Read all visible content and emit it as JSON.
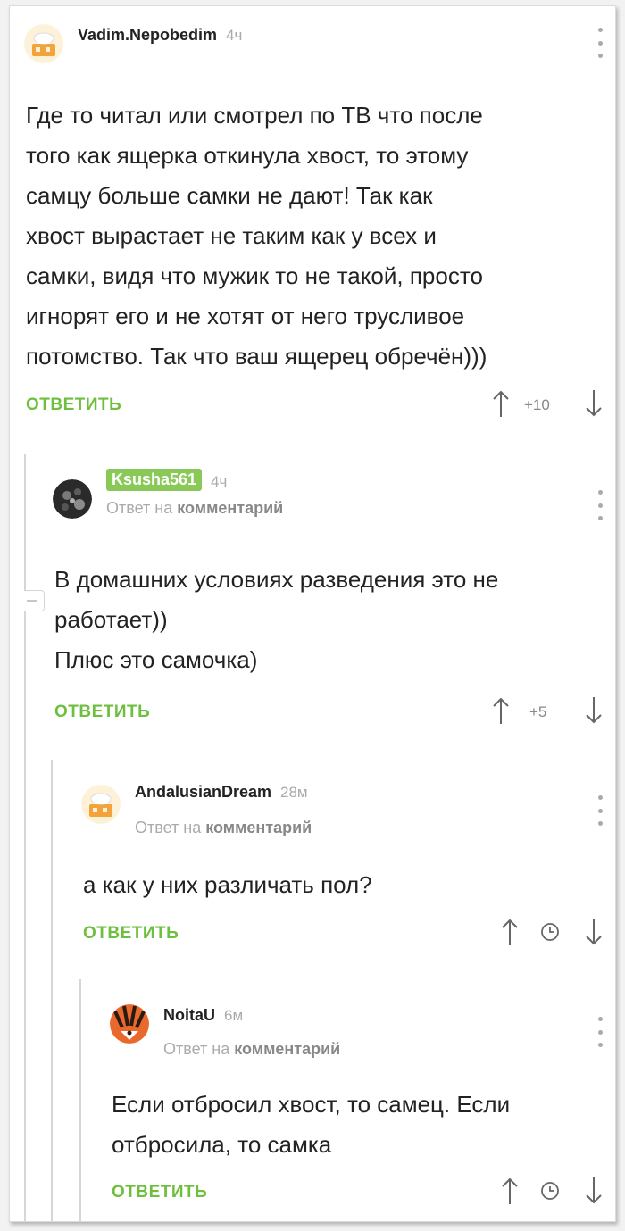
{
  "comments": [
    {
      "username": "Vadim.Nepobedim",
      "time": "4ч",
      "reply_to_prefix": "",
      "reply_to_link": "",
      "text": "Где то читал или смотрел по ТВ что после\nтого как ящерка откинула хвост, то этому\nсамцу больше самки не дают! Так как\nхвост вырастает не таким как у всех и\nсамки, видя что мужик то не такой, просто\nигнорят его и не хотят от него трусливое\nпотомство. Так что ваш ящерец обречён)))",
      "reply_label": "ОТВЕТИТЬ",
      "score": "+10"
    },
    {
      "username": "Ksusha561",
      "time": "4ч",
      "reply_to_prefix": "Ответ на",
      "reply_to_link": "комментарий",
      "text": "В домашних условиях разведения это не\nработает))\nПлюс это самочка)",
      "reply_label": "ОТВЕТИТЬ",
      "score": "+5"
    },
    {
      "username": "AndalusianDream",
      "time": "28м",
      "reply_to_prefix": "Ответ на",
      "reply_to_link": "комментарий",
      "text": "а как у них различать пол?",
      "reply_label": "ОТВЕТИТЬ",
      "score": ""
    },
    {
      "username": "NoitaU",
      "time": "6м",
      "reply_to_prefix": "Ответ на",
      "reply_to_link": "комментарий",
      "text": "Если отбросил хвост, то самец. Если\nотбросила, то самка",
      "reply_label": "ОТВЕТИТЬ",
      "score": ""
    }
  ],
  "icons": {
    "menu": "more-vertical-icon",
    "upvote": "arrow-up-icon",
    "downvote": "arrow-down-icon",
    "pending": "clock-icon"
  },
  "colors": {
    "accent_green": "#6fbf3f",
    "badge_green": "#8ac858",
    "muted": "#aaaaaa"
  }
}
